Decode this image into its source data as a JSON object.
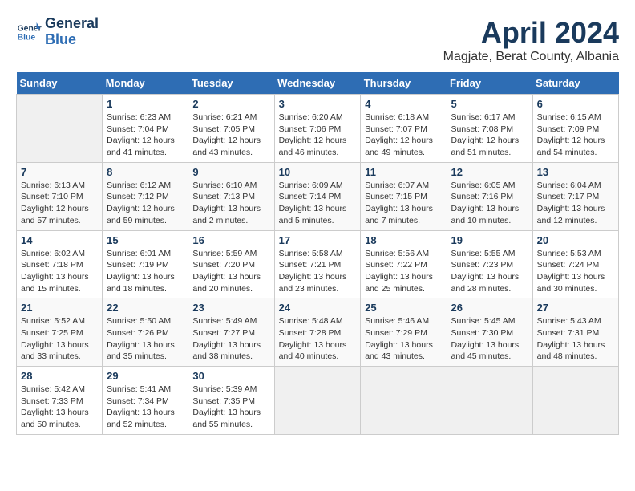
{
  "header": {
    "logo_line1": "General",
    "logo_line2": "Blue",
    "month_year": "April 2024",
    "location": "Magjate, Berat County, Albania"
  },
  "weekdays": [
    "Sunday",
    "Monday",
    "Tuesday",
    "Wednesday",
    "Thursday",
    "Friday",
    "Saturday"
  ],
  "weeks": [
    [
      {
        "day": "",
        "info": ""
      },
      {
        "day": "1",
        "info": "Sunrise: 6:23 AM\nSunset: 7:04 PM\nDaylight: 12 hours\nand 41 minutes."
      },
      {
        "day": "2",
        "info": "Sunrise: 6:21 AM\nSunset: 7:05 PM\nDaylight: 12 hours\nand 43 minutes."
      },
      {
        "day": "3",
        "info": "Sunrise: 6:20 AM\nSunset: 7:06 PM\nDaylight: 12 hours\nand 46 minutes."
      },
      {
        "day": "4",
        "info": "Sunrise: 6:18 AM\nSunset: 7:07 PM\nDaylight: 12 hours\nand 49 minutes."
      },
      {
        "day": "5",
        "info": "Sunrise: 6:17 AM\nSunset: 7:08 PM\nDaylight: 12 hours\nand 51 minutes."
      },
      {
        "day": "6",
        "info": "Sunrise: 6:15 AM\nSunset: 7:09 PM\nDaylight: 12 hours\nand 54 minutes."
      }
    ],
    [
      {
        "day": "7",
        "info": "Sunrise: 6:13 AM\nSunset: 7:10 PM\nDaylight: 12 hours\nand 57 minutes."
      },
      {
        "day": "8",
        "info": "Sunrise: 6:12 AM\nSunset: 7:12 PM\nDaylight: 12 hours\nand 59 minutes."
      },
      {
        "day": "9",
        "info": "Sunrise: 6:10 AM\nSunset: 7:13 PM\nDaylight: 13 hours\nand 2 minutes."
      },
      {
        "day": "10",
        "info": "Sunrise: 6:09 AM\nSunset: 7:14 PM\nDaylight: 13 hours\nand 5 minutes."
      },
      {
        "day": "11",
        "info": "Sunrise: 6:07 AM\nSunset: 7:15 PM\nDaylight: 13 hours\nand 7 minutes."
      },
      {
        "day": "12",
        "info": "Sunrise: 6:05 AM\nSunset: 7:16 PM\nDaylight: 13 hours\nand 10 minutes."
      },
      {
        "day": "13",
        "info": "Sunrise: 6:04 AM\nSunset: 7:17 PM\nDaylight: 13 hours\nand 12 minutes."
      }
    ],
    [
      {
        "day": "14",
        "info": "Sunrise: 6:02 AM\nSunset: 7:18 PM\nDaylight: 13 hours\nand 15 minutes."
      },
      {
        "day": "15",
        "info": "Sunrise: 6:01 AM\nSunset: 7:19 PM\nDaylight: 13 hours\nand 18 minutes."
      },
      {
        "day": "16",
        "info": "Sunrise: 5:59 AM\nSunset: 7:20 PM\nDaylight: 13 hours\nand 20 minutes."
      },
      {
        "day": "17",
        "info": "Sunrise: 5:58 AM\nSunset: 7:21 PM\nDaylight: 13 hours\nand 23 minutes."
      },
      {
        "day": "18",
        "info": "Sunrise: 5:56 AM\nSunset: 7:22 PM\nDaylight: 13 hours\nand 25 minutes."
      },
      {
        "day": "19",
        "info": "Sunrise: 5:55 AM\nSunset: 7:23 PM\nDaylight: 13 hours\nand 28 minutes."
      },
      {
        "day": "20",
        "info": "Sunrise: 5:53 AM\nSunset: 7:24 PM\nDaylight: 13 hours\nand 30 minutes."
      }
    ],
    [
      {
        "day": "21",
        "info": "Sunrise: 5:52 AM\nSunset: 7:25 PM\nDaylight: 13 hours\nand 33 minutes."
      },
      {
        "day": "22",
        "info": "Sunrise: 5:50 AM\nSunset: 7:26 PM\nDaylight: 13 hours\nand 35 minutes."
      },
      {
        "day": "23",
        "info": "Sunrise: 5:49 AM\nSunset: 7:27 PM\nDaylight: 13 hours\nand 38 minutes."
      },
      {
        "day": "24",
        "info": "Sunrise: 5:48 AM\nSunset: 7:28 PM\nDaylight: 13 hours\nand 40 minutes."
      },
      {
        "day": "25",
        "info": "Sunrise: 5:46 AM\nSunset: 7:29 PM\nDaylight: 13 hours\nand 43 minutes."
      },
      {
        "day": "26",
        "info": "Sunrise: 5:45 AM\nSunset: 7:30 PM\nDaylight: 13 hours\nand 45 minutes."
      },
      {
        "day": "27",
        "info": "Sunrise: 5:43 AM\nSunset: 7:31 PM\nDaylight: 13 hours\nand 48 minutes."
      }
    ],
    [
      {
        "day": "28",
        "info": "Sunrise: 5:42 AM\nSunset: 7:33 PM\nDaylight: 13 hours\nand 50 minutes."
      },
      {
        "day": "29",
        "info": "Sunrise: 5:41 AM\nSunset: 7:34 PM\nDaylight: 13 hours\nand 52 minutes."
      },
      {
        "day": "30",
        "info": "Sunrise: 5:39 AM\nSunset: 7:35 PM\nDaylight: 13 hours\nand 55 minutes."
      },
      {
        "day": "",
        "info": ""
      },
      {
        "day": "",
        "info": ""
      },
      {
        "day": "",
        "info": ""
      },
      {
        "day": "",
        "info": ""
      }
    ]
  ]
}
